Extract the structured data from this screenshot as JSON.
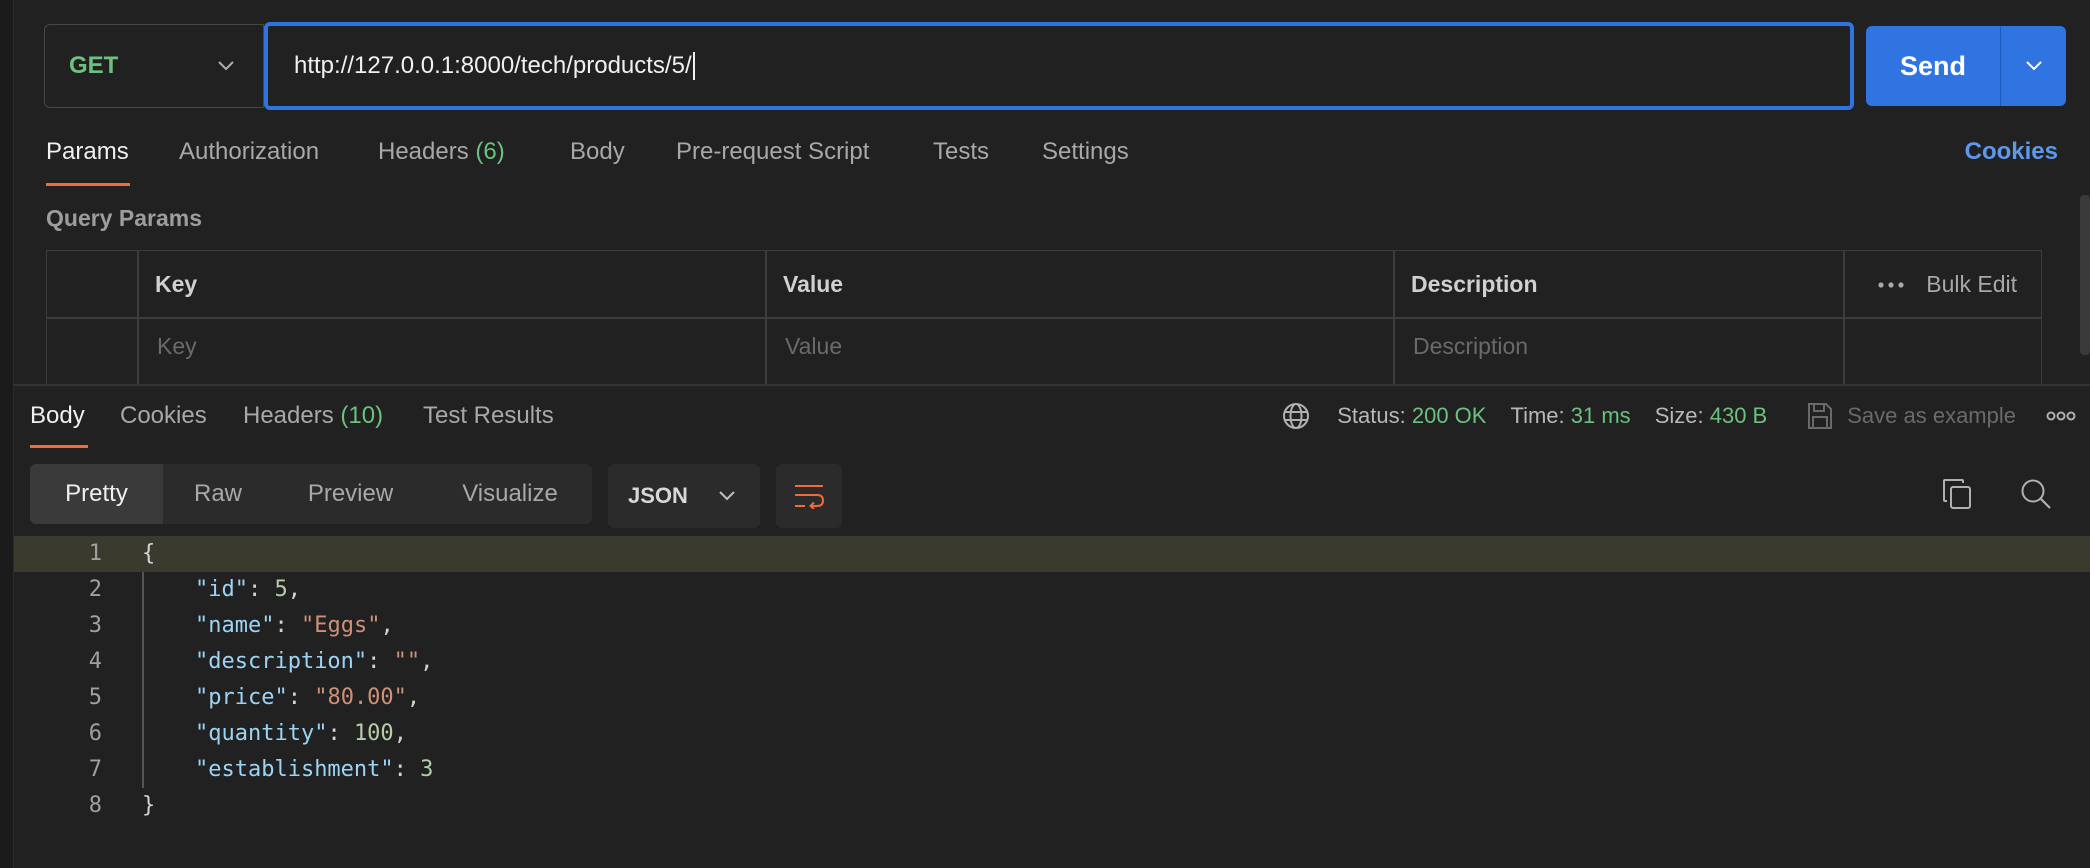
{
  "request": {
    "method": "GET",
    "url": "http://127.0.0.1:8000/tech/products/5/",
    "send_label": "Send"
  },
  "request_tabs": {
    "params": "Params",
    "authorization": "Authorization",
    "headers": "Headers",
    "headers_count": "(6)",
    "body": "Body",
    "pre_request": "Pre-request Script",
    "tests": "Tests",
    "settings": "Settings",
    "cookies": "Cookies"
  },
  "query_params": {
    "title": "Query Params",
    "columns": [
      "Key",
      "Value",
      "Description"
    ],
    "placeholders": [
      "Key",
      "Value",
      "Description"
    ],
    "bulk_edit": "Bulk Edit"
  },
  "response_tabs": {
    "body": "Body",
    "cookies": "Cookies",
    "headers": "Headers",
    "headers_count": "(10)",
    "test_results": "Test Results"
  },
  "response_status": {
    "status_label": "Status:",
    "status_value": "200 OK",
    "time_label": "Time:",
    "time_value": "31 ms",
    "size_label": "Size:",
    "size_value": "430 B",
    "save_example": "Save as example"
  },
  "view_modes": [
    "Pretty",
    "Raw",
    "Preview",
    "Visualize"
  ],
  "format": "JSON",
  "code_lines": [
    {
      "num": "1",
      "text": "{"
    },
    {
      "num": "2",
      "key": "\"id\"",
      "value": "5",
      "vtype": "n",
      "comma": ","
    },
    {
      "num": "3",
      "key": "\"name\"",
      "value": "\"Eggs\"",
      "vtype": "s",
      "comma": ","
    },
    {
      "num": "4",
      "key": "\"description\"",
      "value": "\"\"",
      "vtype": "s",
      "comma": ","
    },
    {
      "num": "5",
      "key": "\"price\"",
      "value": "\"80.00\"",
      "vtype": "s",
      "comma": ","
    },
    {
      "num": "6",
      "key": "\"quantity\"",
      "value": "100",
      "vtype": "n",
      "comma": ","
    },
    {
      "num": "7",
      "key": "\"establishment\"",
      "value": "3",
      "vtype": "n",
      "comma": ""
    },
    {
      "num": "8",
      "text": "}"
    }
  ],
  "colors": {
    "accent": "#2f74e0",
    "success": "#6bc17f",
    "tab_underline": "#ef6b3a",
    "link": "#5d98ec"
  }
}
